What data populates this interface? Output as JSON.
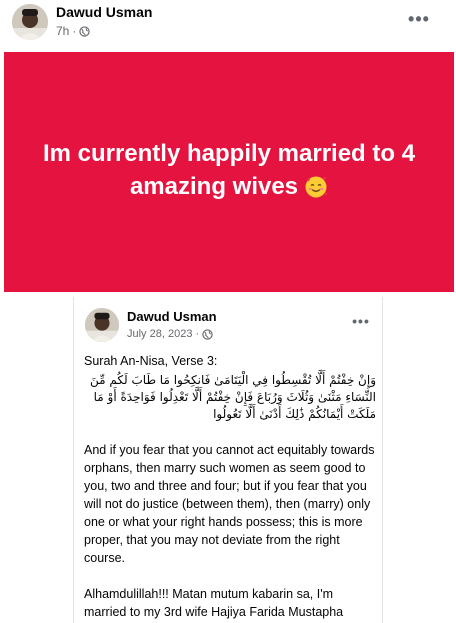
{
  "post": {
    "author": "Dawud Usman",
    "time": "7h",
    "separator": "·",
    "privacy_icon": "globe-icon",
    "more_icon": "more-options-icon",
    "banner_text": "Im currently happily married to 4 amazing wives",
    "banner_emoji": "smiling-face-with-hearts-emoji",
    "banner_color": "#e4133f"
  },
  "shared_post": {
    "author": "Dawud Usman",
    "date": "July 28, 2023",
    "separator": "·",
    "privacy_icon": "globe-icon",
    "more_icon": "more-options-icon",
    "heading": "Surah An-Nisa, Verse 3:",
    "arabic": "وَإِنْ خِفْتُمْ أَلَّا تُقْسِطُوا فِي الْيَتَامَىٰ فَانكِحُوا مَا طَابَ لَكُم مِّنَ النِّسَاءِ مَثْنَىٰ وَثُلَاثَ وَرُبَاعَ فَإِنْ خِفْتُمْ أَلَّا تَعْدِلُوا فَوَاحِدَةً أَوْ مَا مَلَكَتْ أَيْمَانُكُمْ ذَٰلِكَ أَدْنَىٰ أَلَّا تَعُولُوا",
    "translation": "And if you fear that you cannot act equitably towards orphans, then marry such women as seem good to you, two and three and four; but if you fear that you will not do justice (between them), then (marry) only one or what your right hands possess; this is more proper, that you may not deviate from the right course.",
    "closing": "Alhamdulillah!!! Matan mutum kabarin sa, I'm married to my 3rd wife Hajiya Farida Mustapha"
  }
}
